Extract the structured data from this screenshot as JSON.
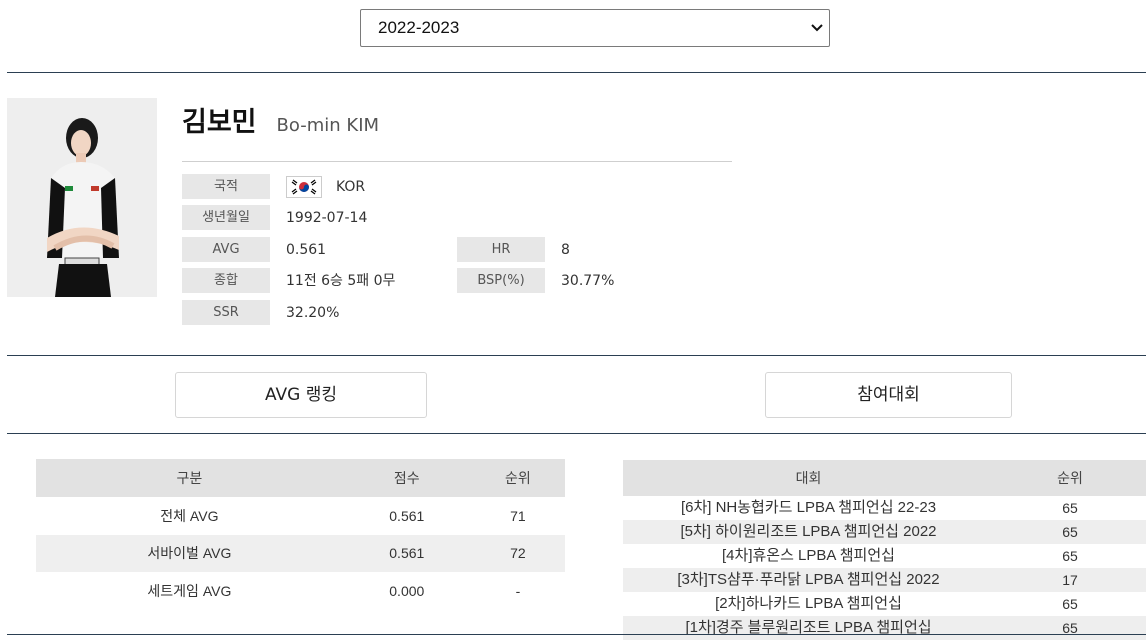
{
  "season_select": {
    "value": "2022-2023"
  },
  "player": {
    "name_ko": "김보민",
    "name_en": "Bo-min KIM",
    "photo": "player-photo",
    "info": {
      "nationality_label": "국적",
      "nationality_value": "KOR",
      "birth_label": "생년월일",
      "birth_value": "1992-07-14",
      "avg_label": "AVG",
      "avg_value": "0.561",
      "hr_label": "HR",
      "hr_value": "8",
      "overall_label": "종합",
      "overall_value": "11전 6승 5패 0무",
      "bsp_label": "BSP(%)",
      "bsp_value": "30.77%",
      "ssr_label": "SSR",
      "ssr_value": "32.20%"
    }
  },
  "buttons": {
    "avg_ranking": "AVG 랭킹",
    "tournaments": "참여대회"
  },
  "avg_table": {
    "headers": [
      "구분",
      "점수",
      "순위"
    ],
    "rows": [
      [
        "전체 AVG",
        "0.561",
        "71"
      ],
      [
        "서바이벌 AVG",
        "0.561",
        "72"
      ],
      [
        "세트게임 AVG",
        "0.000",
        "-"
      ]
    ]
  },
  "tour_table": {
    "headers": [
      "대회",
      "순위"
    ],
    "rows": [
      [
        "[6차] NH농협카드 LPBA 챔피언십 22-23",
        "65"
      ],
      [
        "[5차] 하이원리조트 LPBA 챔피언십 2022",
        "65"
      ],
      [
        "[4차]휴온스 LPBA 챔피언십",
        "65"
      ],
      [
        "[3차]TS샴푸·푸라닭 LPBA 챔피언십 2022",
        "17"
      ],
      [
        "[2차]하나카드 LPBA 챔피언십",
        "65"
      ],
      [
        "[1차]경주 블루원리조트 LPBA 챔피언십",
        "65"
      ]
    ]
  },
  "colors": {
    "divider": "#2b3f52",
    "header_bg": "#e2e2e2",
    "label_bg": "#e7e7e7"
  }
}
